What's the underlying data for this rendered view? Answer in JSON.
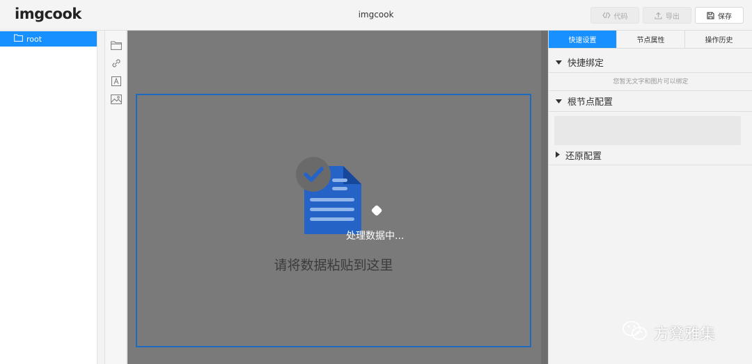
{
  "header": {
    "logo": "imgcook",
    "title": "imgcook",
    "buttons": {
      "code": "代码",
      "export": "导出",
      "save": "保存"
    }
  },
  "tree": {
    "items": [
      {
        "label": "root",
        "icon": "folder-icon"
      }
    ]
  },
  "tools": [
    "folder-icon",
    "link-icon",
    "text-icon",
    "image-icon"
  ],
  "canvas": {
    "drop_hint": "请将数据粘贴到这里",
    "processing": "处理数据中..."
  },
  "panel": {
    "tabs": [
      "快速设置",
      "节点属性",
      "操作历史"
    ],
    "active_tab": "快速设置",
    "sections": {
      "quick_bind": "快捷绑定",
      "quick_bind_note": "您暂无文字和图片可以绑定",
      "root_config": "根节点配置",
      "restore_config": "还原配置"
    }
  },
  "watermark": "方凳雅集",
  "colors": {
    "accent": "#1890ff",
    "canvas": "#7a7a7a",
    "drop_border": "#1d6bc0",
    "doc_blue": "#2563c7"
  }
}
